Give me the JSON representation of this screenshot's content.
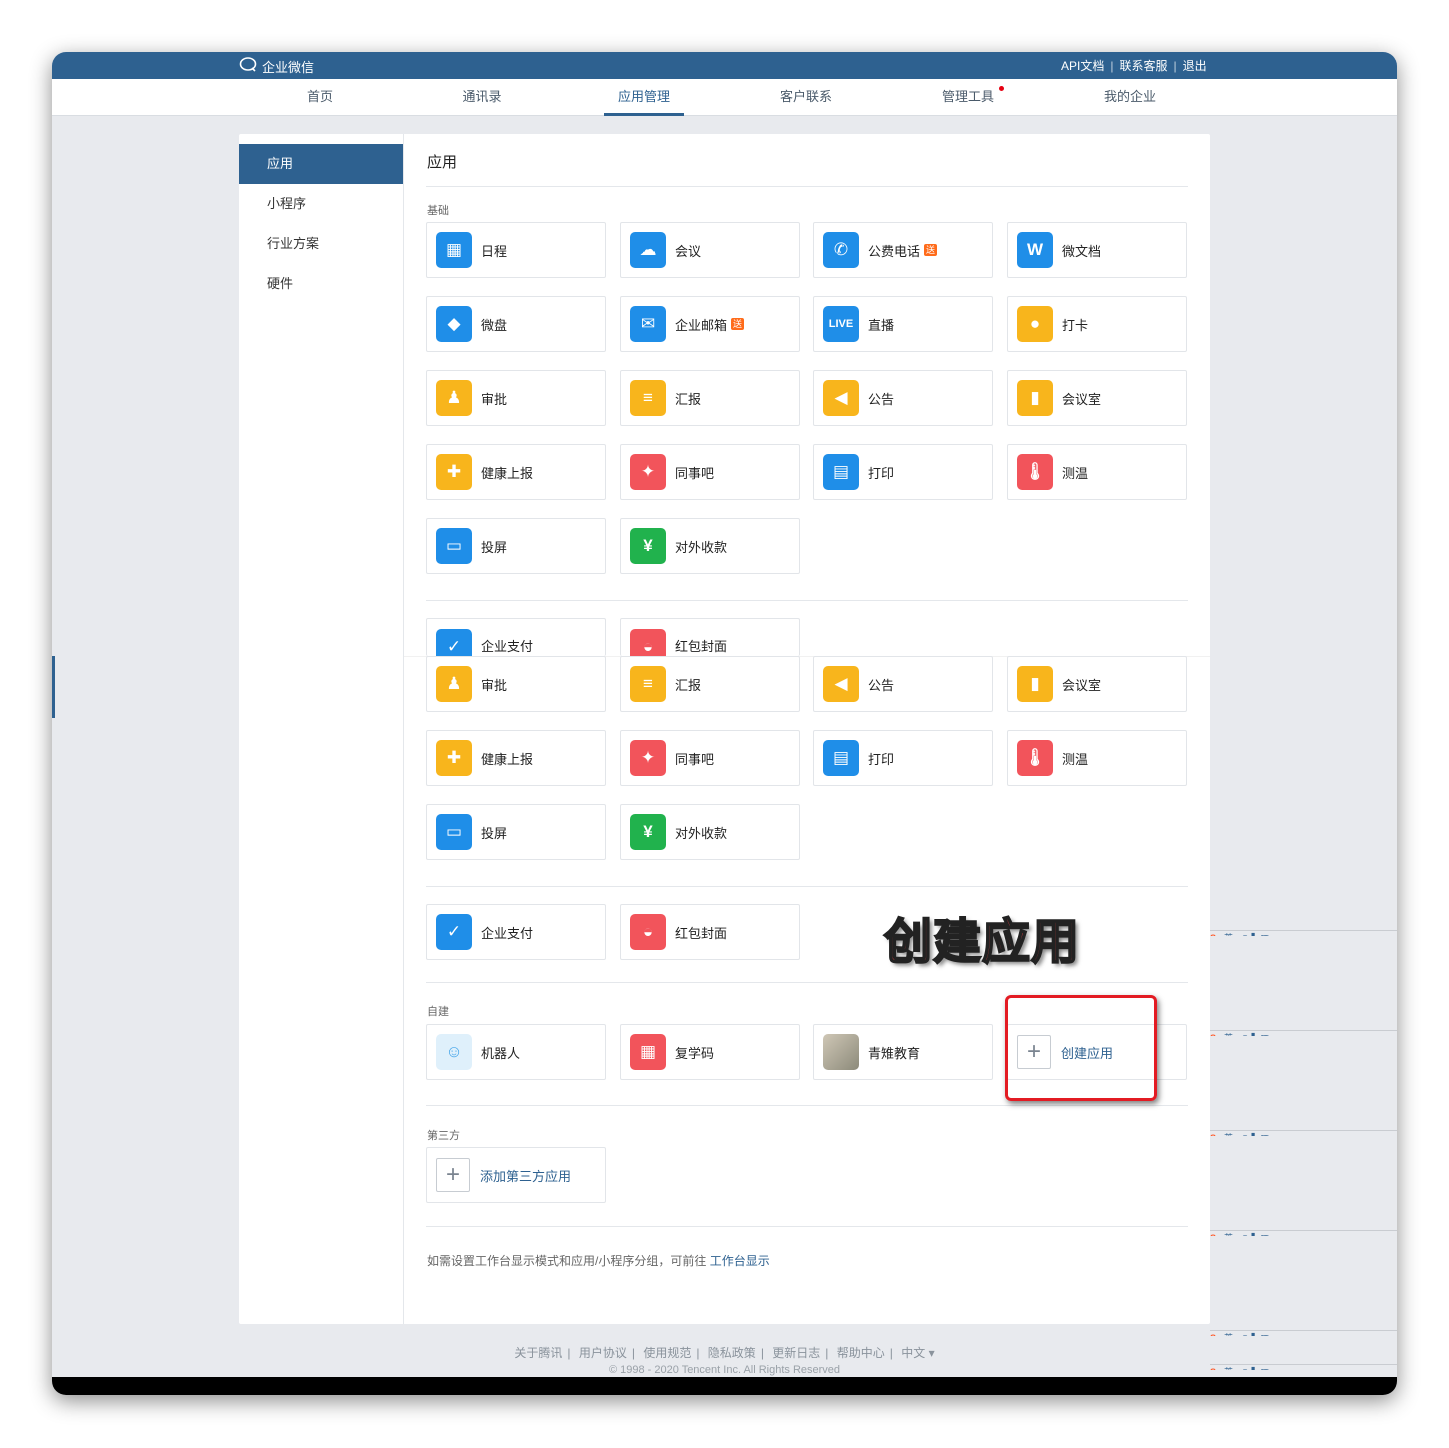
{
  "topbar": {
    "logo": "企业微信",
    "links": [
      "API文档",
      "联系客服",
      "退出"
    ]
  },
  "nav": {
    "items": [
      "首页",
      "通讯录",
      "应用管理",
      "客户联系",
      "管理工具",
      "我的企业"
    ],
    "active": "应用管理"
  },
  "sidebar": {
    "items": [
      "应用",
      "小程序",
      "行业方案",
      "硬件"
    ]
  },
  "main": {
    "title": "应用",
    "section_basic": "基础",
    "basic_apps": [
      "日程",
      "会议",
      "公费电话",
      "微文档",
      "微盘",
      "企业邮箱",
      "直播",
      "打卡",
      "审批",
      "汇报",
      "公告",
      "会议室",
      "健康上报",
      "同事吧",
      "打印",
      "测温",
      "投屏",
      "对外收款"
    ],
    "badge": "送",
    "live_icon": "LIVE",
    "pay_apps": [
      "企业支付",
      "红包封面"
    ],
    "section_custom": "自建",
    "custom_apps": [
      "机器人",
      "复学码",
      "青雉教育"
    ],
    "create_app": "创建应用",
    "section_third": "第三方",
    "add_third": "添加第三方应用",
    "hint": "如需设置工作台显示模式和应用/小程序分组，可前往",
    "hint_link": "工作台显示"
  },
  "annotation": "创建应用",
  "footer": {
    "links": [
      "关于腾讯",
      "用户协议",
      "使用规范",
      "隐私政策",
      "更新日志",
      "帮助中心"
    ],
    "lang": "中文",
    "copyright": "© 1998 - 2020 Tencent Inc. All Rights Reserved"
  },
  "colors": {
    "primary": "#2e6190",
    "blue_icon": "#1f8ee8",
    "yellow_icon": "#f8b51c",
    "red_icon": "#f2545b",
    "green_icon": "#21b24d",
    "annotation": "#e31b23"
  }
}
